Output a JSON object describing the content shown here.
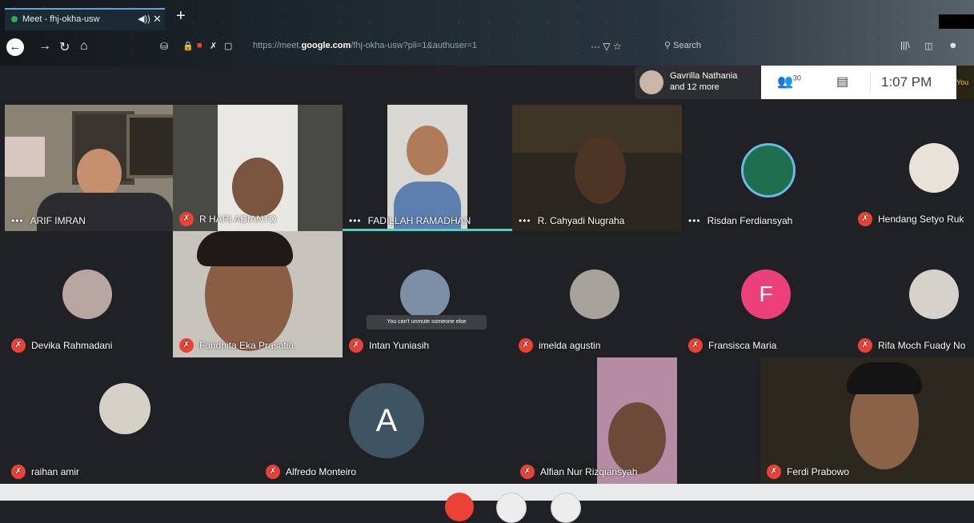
{
  "browser": {
    "tab_title": "Meet - fhj-okha-usw",
    "tab_audio_icon": "◀))",
    "tab_close": "✕",
    "new_tab": "+",
    "url_prefix": "https://meet.",
    "url_domain": "google.com",
    "url_path": "/fhj-okha-usw?pli=1&authuser=1",
    "search_placeholder": "Search",
    "actions": "··· ▽ ☆"
  },
  "meet": {
    "notification": {
      "line1": "Gavrilla Nathania",
      "line2": "and 12 more"
    },
    "participants_count": "30",
    "time": "1:07 PM",
    "you_label": "You"
  },
  "tiles": [
    {
      "name": "ARIF IMRAN",
      "status": "dots"
    },
    {
      "name": "R HARI ADIANTO",
      "status": "muted"
    },
    {
      "name": "FADILLAH RAMADHAN",
      "status": "dots"
    },
    {
      "name": "R. Cahyadi Nugraha",
      "status": "dots"
    },
    {
      "name": "Risdan Ferdiansyah",
      "status": "dots"
    },
    {
      "name": "Hendang Setyo Ruk",
      "status": "muted"
    },
    {
      "name": "Devika Rahmadani",
      "status": "muted"
    },
    {
      "name": "Fandhita Eka Prasatia",
      "status": "muted"
    },
    {
      "name": "Intan Yuniasih",
      "status": "muted"
    },
    {
      "name": "imelda agustin",
      "status": "muted"
    },
    {
      "name": "Fransisca Maria",
      "status": "muted",
      "initial": "F"
    },
    {
      "name": "Rifa Moch Fuady No",
      "status": "muted"
    },
    {
      "name": "raihan amir",
      "status": "muted"
    },
    {
      "name": "Alfredo Monteiro",
      "status": "muted",
      "initial": "A"
    },
    {
      "name": "Alfian Nur Rizqiansyah",
      "status": "muted"
    },
    {
      "name": "Ferdi Prabowo",
      "status": "muted"
    }
  ],
  "tooltip": "You can't unmute someone else",
  "colors": {
    "accent_red": "#ea4335",
    "speaking": "#4dd0c8",
    "tile_bg": "#3c4043"
  }
}
